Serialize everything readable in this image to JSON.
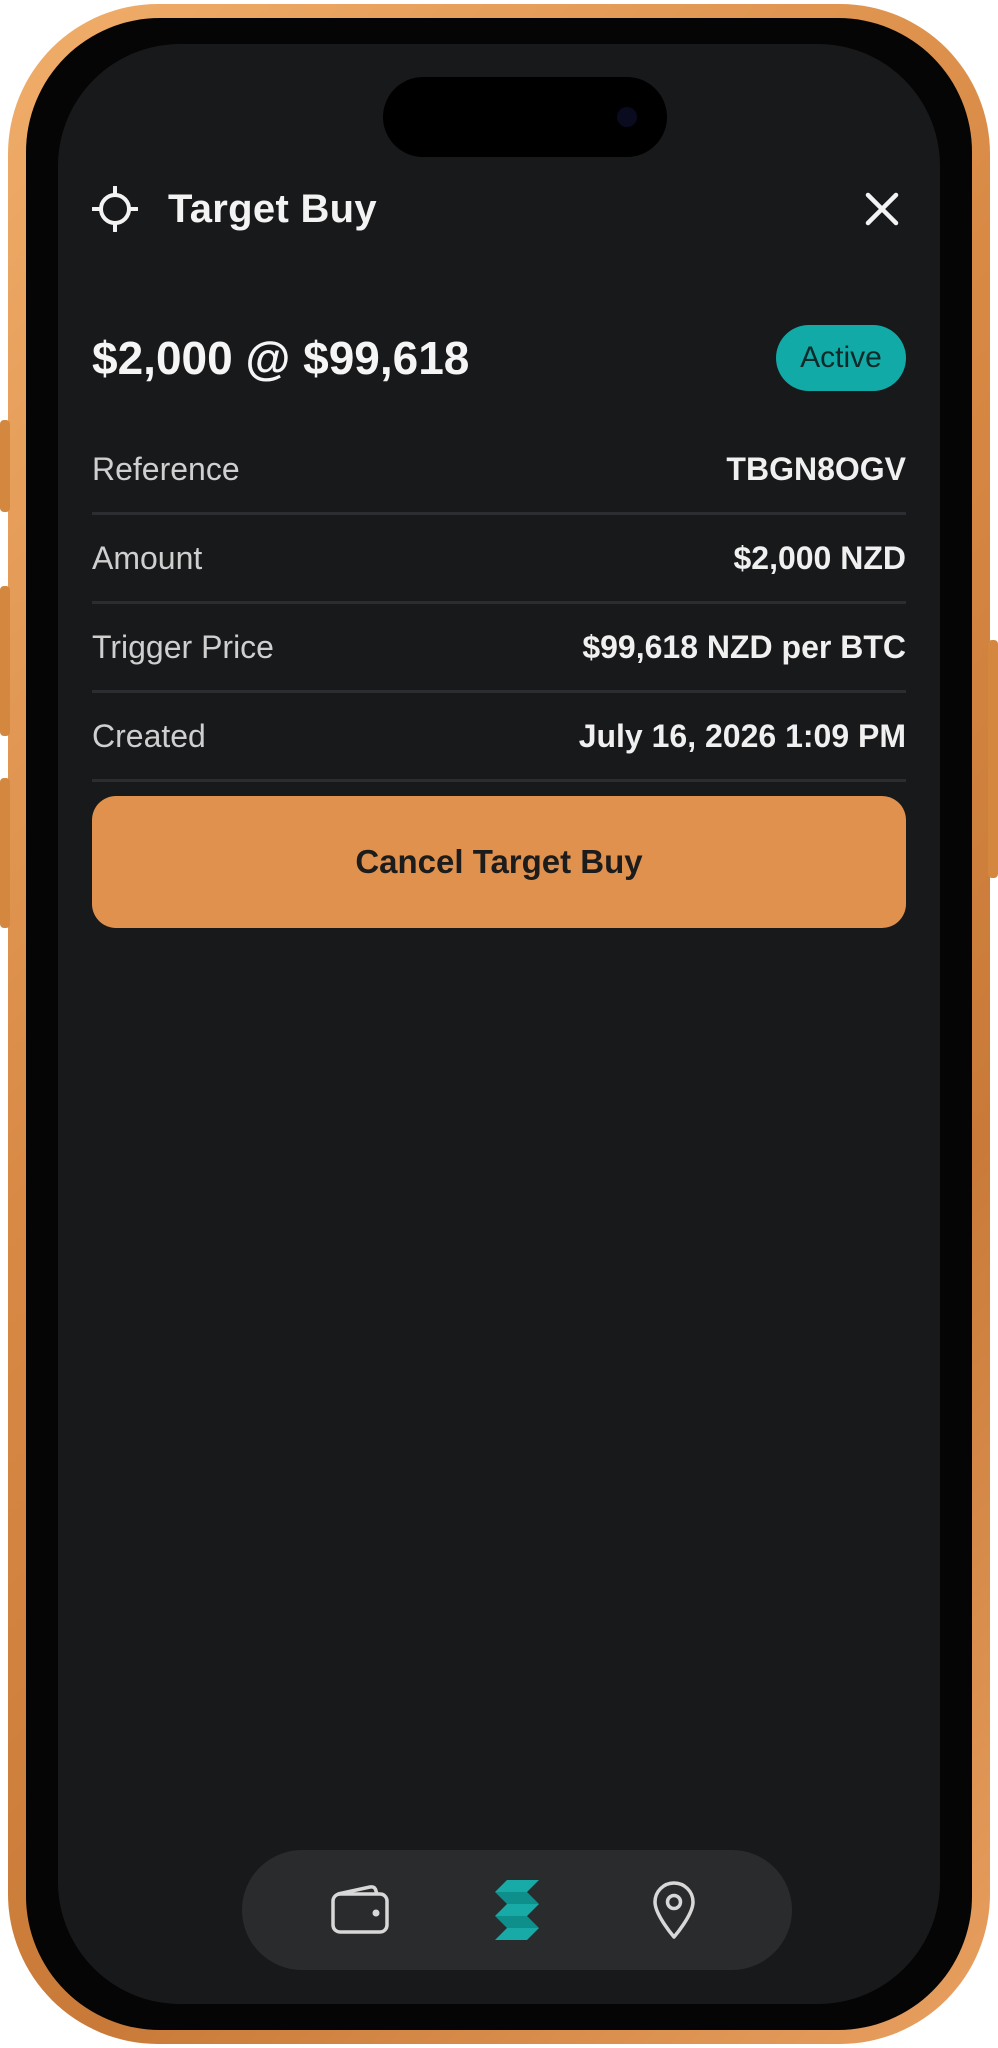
{
  "header": {
    "title": "Target Buy",
    "icon": "crosshair-icon",
    "close_icon": "close-icon"
  },
  "order": {
    "summary": "$2,000 @ $99,618",
    "status": "Active"
  },
  "details": [
    {
      "label": "Reference",
      "value": "TBGN8OGV"
    },
    {
      "label": "Amount",
      "value": "$2,000 NZD"
    },
    {
      "label": "Trigger Price",
      "value": "$99,618 NZD per BTC"
    },
    {
      "label": "Created",
      "value": "July 16, 2026 1:09 PM"
    }
  ],
  "actions": {
    "cancel_label": "Cancel Target Buy"
  },
  "nav": {
    "items": [
      {
        "icon": "wallet-icon"
      },
      {
        "icon": "brand-logo-icon"
      },
      {
        "icon": "location-pin-icon"
      }
    ]
  },
  "colors": {
    "accent_orange": "#e0914d",
    "status_teal": "#12aaa6",
    "background": "#18191b"
  }
}
